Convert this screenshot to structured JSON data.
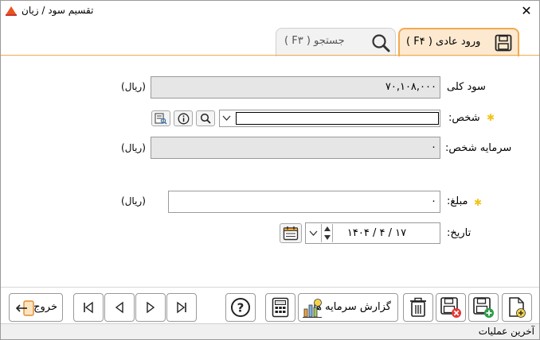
{
  "window": {
    "title": "تقسیم سود / زیان",
    "close_symbol": "✕"
  },
  "tabs": [
    {
      "label": "ورود عادی ( F۴ )",
      "icon": "save-icon",
      "active": true
    },
    {
      "label": "جستجو ( F۳ )",
      "icon": "search-icon",
      "active": false
    }
  ],
  "form": {
    "total_profit": {
      "label": "سود کلی",
      "value": "۷۰,۱۰۸,۰۰۰",
      "unit": "(ریال)"
    },
    "person": {
      "label": "شخص:",
      "value": "",
      "required": true
    },
    "person_capital": {
      "label": "سرمایه شخص:",
      "value": "۰",
      "unit": "(ریال)"
    },
    "amount": {
      "label": "مبلغ:",
      "value": "۰",
      "unit": "(ریال)",
      "required": true
    },
    "date": {
      "label": "تاریخ:",
      "value": "۱۴۰۴ / ۴ / ۱۷"
    }
  },
  "toolbar": {
    "exit_label": "خروج",
    "capital_report_label": "گزارش سرمایه ها"
  },
  "status": {
    "text": "آخرین عملیات"
  },
  "colors": {
    "tab_active_bg": "#fde9cf",
    "tab_active_border": "#f3a94e",
    "required_star": "#f0c419"
  }
}
